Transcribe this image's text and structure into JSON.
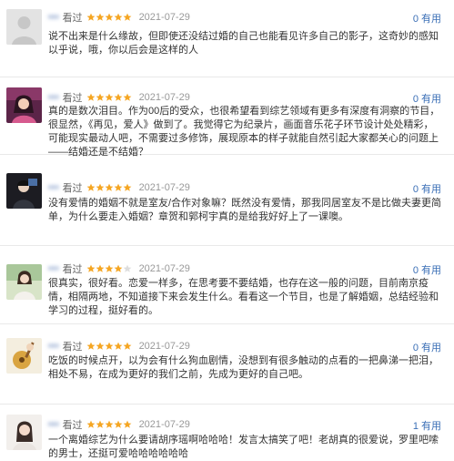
{
  "colors": {
    "star": "#f5a623",
    "star_empty": "#dddddd",
    "link": "#3b6fb6"
  },
  "comments": [
    {
      "user": "•••",
      "action": "看过",
      "rating": 5,
      "date": "2021-07-29",
      "useful": "0 有用",
      "text": "说不出来是什么缘故，但即使还没结过婚的自己也能看见许多自己的影子，这奇妙的感知以乎说，哦，你以后会是这样的人"
    },
    {
      "user": "•••",
      "action": "看过",
      "rating": 5,
      "date": "2021-07-29",
      "useful": "0 有用",
      "text": "真的是数次泪目。作为00后的受众，也很希望看到综艺领域有更多有深度有洞察的节目，很显然，《再见，爱人》做到了。我觉得它为纪录片，画面音乐花子环节设计处处精彩，可能现实最动人吧，不需要过多修饰，展现原本的样子就能自然引起大家都关心的问题上——结婚还是不结婚？"
    },
    {
      "user": "•••",
      "action": "看过",
      "rating": 5,
      "date": "2021-07-29",
      "useful": "0 有用",
      "text": "没有爱情的婚姻不就是室友/合作对象嘛？既然没有爱情，那我同居室友不是比做夫妻更简单，为什么要走入婚姻？章贺和郭柯宇真的是给我好好上了一课噢。"
    },
    {
      "user": "•••",
      "action": "看过",
      "rating": 4,
      "date": "2021-07-29",
      "useful": "0 有用",
      "text": "很真实，很好看。恋爱一样多，在思考要不要结婚，也存在这一般的问题，目前南京疫情，相隔两地，不知道接下来会发生什么。看看这一个节目，也是了解婚姻，总结经验和学习的过程，挺好看的。"
    },
    {
      "user": "•••",
      "action": "看过",
      "rating": 5,
      "date": "2021-07-29",
      "useful": "0 有用",
      "text": "吃饭的时候点开，以为会有什么狗血剧情，没想到有很多触动的点看的一把鼻涕一把泪，相处不易，在成为更好的我们之前，先成为更好的自己吧。"
    },
    {
      "user": "•••",
      "action": "看过",
      "rating": 5,
      "date": "2021-07-29",
      "useful": "1 有用",
      "text": "一个离婚综艺为什么要请胡序瑶啊哈哈哈！发言太搞笑了吧！老胡真的很爱说，罗里吧嗦的男士，还挺可爱哈哈哈哈哈哈"
    }
  ]
}
